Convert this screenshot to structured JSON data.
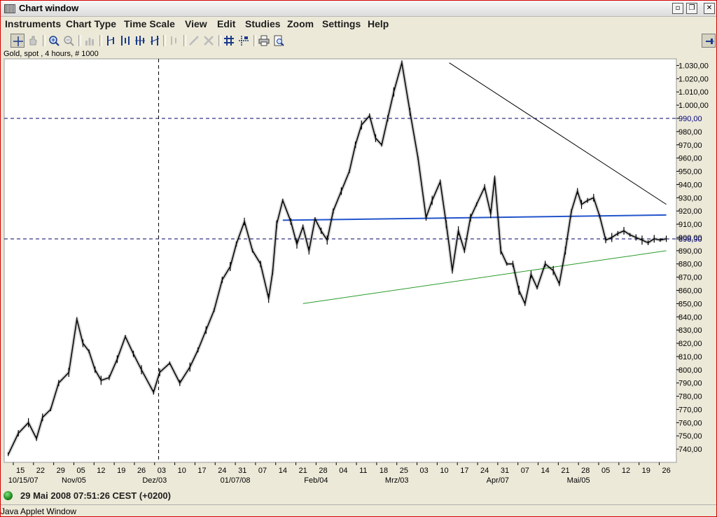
{
  "window": {
    "title": "Chart window"
  },
  "menu": [
    "Instruments",
    "Chart Type",
    "Time Scale",
    "View",
    "Edit",
    "Studies",
    "Zoom",
    "Settings",
    "Help"
  ],
  "toolbar": {
    "buttons": [
      "cursor-icon",
      "pan-icon",
      "zoom-in-icon",
      "zoom-out-icon",
      "bar-chart-icon",
      "candle-a-icon",
      "candle-b-icon",
      "candle-c-icon",
      "candle-d-icon",
      "indicator-icon",
      "draw-line-icon",
      "delete-icon",
      "grid-icon",
      "crosshair-grid-icon",
      "print-icon",
      "print-preview-icon"
    ],
    "pin_icon": "pin-icon"
  },
  "chart_header": "Gold, spot , 4 hours, # 1000",
  "status": {
    "text": "29 Mai 2008 07:51:26  CEST (+0200)",
    "indicator_color": "#1d8a1d"
  },
  "applet_label": "Java Applet Window",
  "colors": {
    "price": "#000000",
    "trend_blue": "#2255cc",
    "trend_green": "#2a9a2a",
    "dashed": "#000066",
    "highlight_label": "#000080"
  },
  "chart_data": {
    "type": "line",
    "instrument": "Gold, spot , 4 hours, # 1000",
    "ylim": [
      730,
      1035
    ],
    "y_ticks": [
      "1.030,00",
      "1.020,00",
      "1.010,00",
      "1.000,00",
      "990,00",
      "980,00",
      "970,00",
      "960,00",
      "950,00",
      "940,00",
      "930,00",
      "920,00",
      "910,00",
      "900,00",
      "898,90",
      "890,00",
      "880,00",
      "870,00",
      "860,00",
      "850,00",
      "840,00",
      "830,00",
      "820,00",
      "810,00",
      "800,00",
      "790,00",
      "780,00",
      "770,00",
      "760,00",
      "750,00",
      "740,00"
    ],
    "y_tick_values": [
      1030,
      1020,
      1010,
      1000,
      990,
      980,
      970,
      960,
      950,
      940,
      930,
      920,
      910,
      900,
      898.9,
      890,
      880,
      870,
      860,
      850,
      840,
      830,
      820,
      810,
      800,
      790,
      780,
      770,
      760,
      750,
      740
    ],
    "highlight_ticks": [
      "990,00",
      "898,90"
    ],
    "x_ticks": [
      "15",
      "22",
      "29",
      "05",
      "12",
      "19",
      "26",
      "03",
      "10",
      "17",
      "24",
      "31",
      "07",
      "14",
      "21",
      "28",
      "04",
      "11",
      "18",
      "25",
      "03",
      "10",
      "17",
      "24",
      "31",
      "07",
      "14",
      "21",
      "28",
      "05",
      "12",
      "19",
      "26"
    ],
    "x_tick_index": [
      0.25,
      1.25,
      2.25,
      3.25,
      4.25,
      5.25,
      6.25,
      7.25,
      8.25,
      9.25,
      10.25,
      11.25,
      12.25,
      13.25,
      14.25,
      15.25,
      16.25,
      17.25,
      18.25,
      19.25,
      20.25,
      21.25,
      22.25,
      23.25,
      24.25,
      25.25,
      26.25,
      27.25,
      28.25,
      29.25,
      30.25,
      31.25,
      32.25
    ],
    "x_period_labels": [
      {
        "label": "10/15/07",
        "week": 0
      },
      {
        "label": "Nov/05",
        "week": 3.25
      },
      {
        "label": "Dez/03",
        "week": 7.25
      },
      {
        "label": "01/07/08",
        "week": 11.25
      },
      {
        "label": "Feb/04",
        "week": 15.25
      },
      {
        "label": "Mrz/03",
        "week": 19.25
      },
      {
        "label": "Apr/07",
        "week": 24.25
      },
      {
        "label": "Mai/05",
        "week": 28.25
      }
    ],
    "xlim_weeks": [
      -0.2,
      33.1
    ],
    "series": [
      {
        "x_weeks": [
          0,
          0.5,
          1,
          1.4,
          1.7,
          2.1,
          2.5,
          3,
          3.4,
          3.7,
          4,
          4.3,
          4.6,
          5,
          5.4,
          5.8,
          6.2,
          6.6,
          7.2,
          7.5,
          8,
          8.5,
          9,
          9.4,
          9.8,
          10.2,
          10.6,
          11,
          11.3,
          11.7,
          12.1,
          12.5,
          12.9,
          13.1,
          13.3,
          13.6,
          14,
          14.3,
          14.6,
          14.9,
          15.2,
          15.5,
          15.8,
          16.1,
          16.5,
          16.9,
          17.2,
          17.5,
          17.9,
          18.2,
          18.5,
          18.8,
          19.1,
          19.5,
          19.9,
          20.3,
          20.7,
          21,
          21.4,
          21.7,
          21.85,
          22,
          22.3,
          22.6,
          22.9,
          23.2,
          23.6,
          23.9,
          24.1,
          24.4,
          24.7,
          25,
          25.3,
          25.6,
          25.9,
          26.2,
          26.6,
          27,
          27.3,
          27.6,
          27.9,
          28.2,
          28.4,
          28.7,
          29,
          29.3,
          29.6,
          29.9,
          30.2,
          30.5,
          30.8,
          31.1,
          31.4,
          31.7,
          32,
          32.3,
          32.6
        ],
        "y": [
          736,
          752,
          760,
          748,
          764,
          770,
          790,
          798,
          838,
          820,
          814,
          800,
          792,
          794,
          808,
          825,
          812,
          800,
          783,
          798,
          805,
          790,
          802,
          815,
          830,
          845,
          868,
          878,
          895,
          912,
          890,
          880,
          854,
          874,
          910,
          928,
          912,
          895,
          908,
          890,
          914,
          905,
          898,
          920,
          935,
          950,
          970,
          985,
          992,
          975,
          970,
          990,
          1010,
          1032,
          995,
          960,
          915,
          928,
          942,
          910,
          893,
          875,
          905,
          890,
          915,
          925,
          938,
          918,
          945,
          890,
          880,
          880,
          860,
          850,
          872,
          862,
          880,
          875,
          865,
          890,
          920,
          935,
          925,
          928,
          930,
          916,
          898,
          900,
          903,
          905,
          902,
          900,
          898,
          896,
          899,
          898,
          899
        ]
      }
    ],
    "annotations": [
      {
        "kind": "trendline",
        "color": "blue",
        "from": [
          13.6,
          913
        ],
        "to": [
          32.6,
          917
        ]
      },
      {
        "kind": "trendline",
        "color": "green",
        "from": [
          14.6,
          850
        ],
        "to": [
          32.6,
          890
        ]
      },
      {
        "kind": "trendline",
        "color": "black",
        "from": [
          21.85,
          1032
        ],
        "to": [
          32.6,
          925
        ]
      },
      {
        "kind": "hline",
        "style": "dashed",
        "value": 990
      },
      {
        "kind": "hline",
        "style": "dashed",
        "value": 898.9
      },
      {
        "kind": "vline",
        "style": "dashed",
        "week": 7.45
      }
    ],
    "grid": false,
    "legend": "none"
  }
}
